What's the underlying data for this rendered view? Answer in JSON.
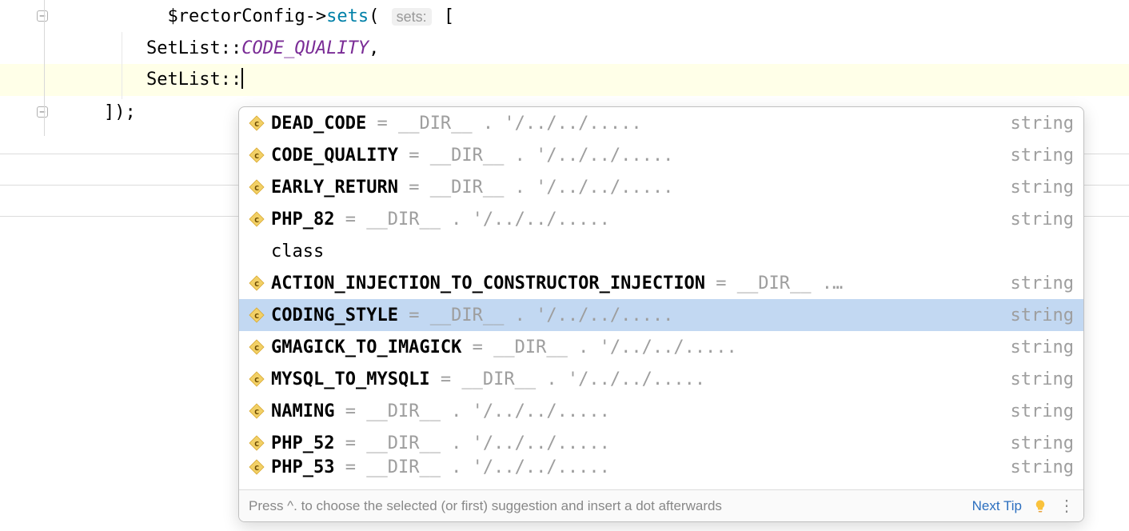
{
  "code": {
    "line1_prefix": "$rectorConfig",
    "line1_arrow": "->",
    "line1_method": "sets",
    "line1_hint": "sets:",
    "line1_open": "( ",
    "line1_brace": " [",
    "line2_class": "SetList",
    "line2_scope": "::",
    "line2_const": "CODE_QUALITY",
    "line2_comma": ",",
    "line3_class": "SetList",
    "line3_scope": "::",
    "line4_close": "]);"
  },
  "completion": {
    "items": [
      {
        "icon": "c",
        "name": "DEAD_CODE",
        "value": " = __DIR__ . '/../../.....",
        "type": "string",
        "selected": false
      },
      {
        "icon": "c",
        "name": "CODE_QUALITY",
        "value": " = __DIR__ . '/../../.....",
        "type": "string",
        "selected": false
      },
      {
        "icon": "c",
        "name": "EARLY_RETURN",
        "value": " = __DIR__ . '/../../.....",
        "type": "string",
        "selected": false
      },
      {
        "icon": "c",
        "name": "PHP_82",
        "value": " = __DIR__ . '/../../.....",
        "type": "string",
        "selected": false
      },
      {
        "icon": "",
        "name": "",
        "value": "class",
        "type": "",
        "selected": false,
        "plain": true
      },
      {
        "icon": "c",
        "name": "ACTION_INJECTION_TO_CONSTRUCTOR_INJECTION",
        "value": " = __DIR__ .…",
        "type": "string",
        "selected": false
      },
      {
        "icon": "c",
        "name": "CODING_STYLE",
        "value": " = __DIR__ . '/../../.....",
        "type": "string",
        "selected": true
      },
      {
        "icon": "c",
        "name": "GMAGICK_TO_IMAGICK",
        "value": " = __DIR__ . '/../../.....",
        "type": "string",
        "selected": false
      },
      {
        "icon": "c",
        "name": "MYSQL_TO_MYSQLI",
        "value": " = __DIR__ . '/../../.....",
        "type": "string",
        "selected": false
      },
      {
        "icon": "c",
        "name": "NAMING",
        "value": " = __DIR__ . '/../../.....",
        "type": "string",
        "selected": false
      },
      {
        "icon": "c",
        "name": "PHP_52",
        "value": " = __DIR__ . '/../../.....",
        "type": "string",
        "selected": false
      },
      {
        "icon": "c",
        "name": "PHP_53",
        "value": " = __DIR__ . '/../../.....",
        "type": "string",
        "selected": false,
        "partial": true
      }
    ],
    "footer_tip": "Press ^. to choose the selected (or first) suggestion and insert a dot afterwards",
    "next_tip": "Next Tip"
  }
}
